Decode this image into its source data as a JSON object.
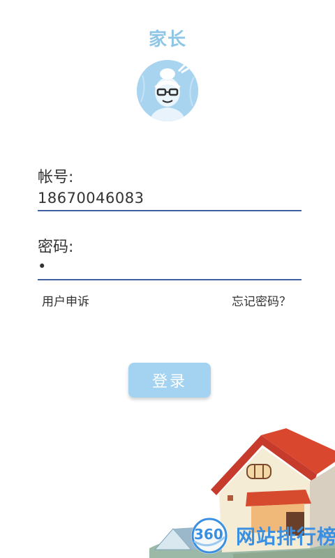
{
  "header": {
    "title": "家长"
  },
  "avatar": {
    "icon": "cartoon-girl-avatar"
  },
  "form": {
    "account_label": "帐号:",
    "account_value": "18670046083",
    "password_label": "密码:",
    "password_value": "•"
  },
  "links": {
    "appeal": "用户申诉",
    "forgot_password": "忘记密码？"
  },
  "actions": {
    "login_label": "登录"
  },
  "watermark": {
    "logo_text": "360",
    "text": "网站排行榜"
  },
  "colors": {
    "accent": "#8fc6e6",
    "button": "#a3d3f0",
    "underline": "#3f5f9f",
    "watermark": "#3a8fe0"
  }
}
